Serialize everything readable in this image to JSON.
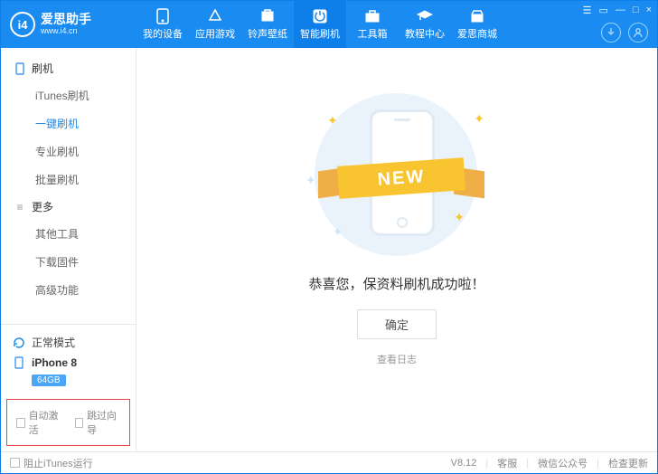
{
  "brand": {
    "logo_text": "i4",
    "title": "爱思助手",
    "subtitle": "www.i4.cn"
  },
  "nav": [
    {
      "label": "我的设备"
    },
    {
      "label": "应用游戏"
    },
    {
      "label": "铃声壁纸"
    },
    {
      "label": "智能刷机",
      "active": true
    },
    {
      "label": "工具箱"
    },
    {
      "label": "教程中心"
    },
    {
      "label": "爱思商城"
    }
  ],
  "win_controls": [
    "☰",
    "▭",
    "—",
    "□",
    "×"
  ],
  "sidebar": {
    "groups": [
      {
        "title": "刷机",
        "items": [
          {
            "label": "iTunes刷机"
          },
          {
            "label": "一键刷机",
            "active": true
          },
          {
            "label": "专业刷机"
          },
          {
            "label": "批量刷机"
          }
        ]
      },
      {
        "title": "更多",
        "items": [
          {
            "label": "其他工具"
          },
          {
            "label": "下载固件"
          },
          {
            "label": "高级功能"
          }
        ]
      }
    ],
    "mode_label": "正常模式",
    "device_name": "iPhone 8",
    "device_badge": "64GB",
    "checks": {
      "auto_activate": "自动激活",
      "skip_guide": "跳过向导"
    }
  },
  "main": {
    "ribbon_text": "NEW",
    "success_text": "恭喜您，保资料刷机成功啦！",
    "ok_label": "确定",
    "log_label": "查看日志"
  },
  "footer": {
    "block_itunes": "阻止iTunes运行",
    "version": "V8.12",
    "links": [
      "客服",
      "微信公众号",
      "检查更新"
    ]
  }
}
